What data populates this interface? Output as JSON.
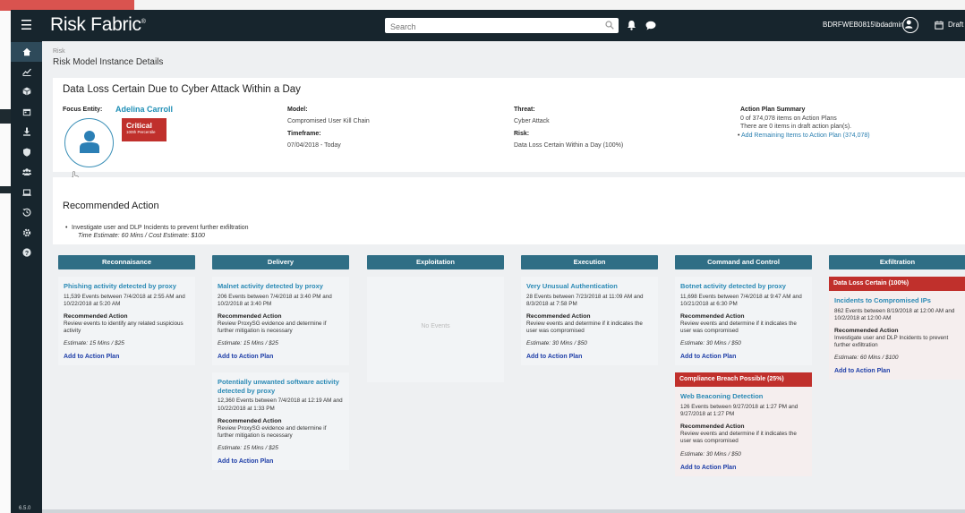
{
  "app": {
    "name": "Risk Fabric",
    "version": "6.5.0",
    "search_placeholder": "Search",
    "username": "BDRFWEB0815\\bdadmin",
    "draft_label": "Draft ("
  },
  "breadcrumb": "Risk",
  "page_title": "Risk Model Instance Details",
  "incident": {
    "title": "Data Loss Certain Due to Cyber Attack Within a Day",
    "focus_entity_label": "Focus Entity:",
    "focus_entity_name": "Adelina Carroll",
    "severity": "Critical",
    "percentile": "100th Percentile",
    "model_label": "Model:",
    "model": "Compromised User Kill Chain",
    "timeframe_label": "Timeframe:",
    "timeframe": "07/04/2018 - Today",
    "threat_label": "Threat:",
    "threat": "Cyber Attack",
    "risk_label": "Risk:",
    "risk": "Data Loss Certain Within a Day (100%)",
    "action_plan_label": "Action Plan Summary",
    "action_plan_line1": "0 of 374,078 items on Action Plans",
    "action_plan_line2": "There are 0 items in draft action plan(s).",
    "action_plan_link": "Add Remaining Items to Action Plan (374,078)"
  },
  "recommended_action": {
    "title": "Recommended Action",
    "item": "Investigate user and DLP Incidents to prevent further exfiltration",
    "estimate": "Time Estimate: 60 Mins / Cost Estimate: $100"
  },
  "common": {
    "rec_heading": "Recommended Action",
    "add_label": "Add to Action Plan",
    "no_events": "No Events"
  },
  "stages": [
    {
      "name": "Reconnaisance",
      "tiles": [
        {
          "title": "Phishing activity detected by proxy",
          "events": "11,539 Events between 7/4/2018 at 2:55 AM and 10/22/2018 at 5:20 AM",
          "text": "Review events to identify any related suspicious activity",
          "estimate": "Estimate: 15 Mins / $25"
        }
      ]
    },
    {
      "name": "Delivery",
      "tiles": [
        {
          "title": "Malnet activity detected by proxy",
          "events": "206 Events between 7/4/2018 at 3:40 PM and 10/2/2018 at 3:40 PM",
          "text": "Review ProxySG evidence and determine if further mitigation is necessary",
          "estimate": "Estimate: 15 Mins / $25"
        },
        {
          "title": "Potentially unwanted software activity detected by proxy",
          "events": "12,360 Events between 7/4/2018 at 12:19 AM and 10/22/2018 at 1:33 PM",
          "text": "Review ProxySG evidence and determine if further mitigation is necessary",
          "estimate": "Estimate: 15 Mins / $25"
        }
      ]
    },
    {
      "name": "Exploitation",
      "tiles": []
    },
    {
      "name": "Execution",
      "tiles": [
        {
          "title": "Very Unusual Authentication",
          "events": "28 Events between 7/23/2018 at 11:09 AM and 8/3/2018 at 7:58 PM",
          "text": "Review events and determine if it indicates the user was compromised",
          "estimate": "Estimate: 30 Mins / $50"
        }
      ]
    },
    {
      "name": "Command and Control",
      "tiles": [
        {
          "title": "Botnet activity detected by proxy",
          "events": "11,698 Events between 7/4/2018 at 9:47 AM and 10/21/2018 at 6:30 PM",
          "text": "Review events and determine if it indicates the user was compromised",
          "estimate": "Estimate: 30 Mins / $50"
        }
      ],
      "banner": "Compliance Breach Possible (25%)",
      "banner_tile": {
        "title": "Web Beaconing Detection",
        "events": "126 Events between 9/27/2018 at 1:27 PM and 9/27/2018 at 1:27 PM",
        "text": "Review events and determine if it indicates the user was compromised",
        "estimate": "Estimate: 30 Mins / $50"
      }
    },
    {
      "name": "Exfiltration",
      "banner": "Data Loss Certain (100%)",
      "banner_tile": {
        "title": "Incidents to Compromised IPs",
        "events": "862 Events between 8/19/2018 at 12:00 AM and 10/2/2018 at 12:00 AM",
        "text": "Investigate user and DLP Incidents to prevent further exfiltration",
        "estimate": "Estimate: 60 Mins / $100"
      }
    }
  ],
  "colors": {
    "topbar": "#17252d",
    "stage_header": "#2f6e85",
    "critical": "#c0302c",
    "link": "#2b8ab5",
    "add_link": "#1f3fa8"
  }
}
